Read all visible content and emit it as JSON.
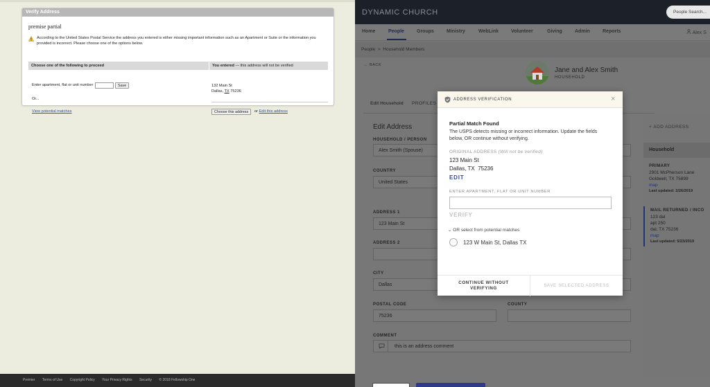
{
  "left": {
    "panel_title": "Verify Address",
    "premise": "premise partial",
    "warning": "According to the United States Postal Service the address you entered is either missing important information such as an Apartment or Suite or the information you provided is incorrect. Please choose one of the options below.",
    "choose_header": "Choose one of the following to proceed",
    "entered_header_bold": "You entered",
    "entered_header_rest": " — this address will not be verified",
    "apt_label": "Enter apartment, flat or unit number",
    "save_label": "Save",
    "or_label": "Or...",
    "view_matches": "View potential matches",
    "entered_line1": "132 Main St",
    "entered_city": "Dallas, ",
    "entered_state": "TX",
    "entered_zip": " 75236",
    "choose_button": "Choose this address",
    "or_small": " or ",
    "edit_link": "Edit this address",
    "footer": [
      "Premier",
      "Terms of Use",
      "Copyright Policy",
      "Your Privacy Rights",
      "Security",
      "© 2018 Fellowship One"
    ]
  },
  "right": {
    "brand": "DYNAMIC CHURCH",
    "search_placeholder": "People Search...",
    "nav": [
      "Home",
      "People",
      "Groups",
      "Ministry",
      "WebLink",
      "Volunteer",
      "Giving",
      "Admin",
      "Reports"
    ],
    "active_nav": "People",
    "user": "Alex S",
    "breadcrumb": [
      "People",
      "Household Members"
    ],
    "back": "BACK",
    "household_name": "Jane and Alex Smith",
    "household_type": "HOUSEHOLD",
    "tabs": [
      "Edit Household",
      "PROFILES"
    ],
    "form": {
      "title": "Edit Address",
      "household_label": "HOUSEHOLD / PERSON",
      "household_value": "Alex Smith (Spouse)",
      "country_label": "COUNTRY",
      "country_value": "United States",
      "address1_label": "ADDRESS 1",
      "address1_value": "123 Main St",
      "address2_label": "ADDRESS 2",
      "address2_value": "",
      "city_label": "CITY",
      "city_value": "Dallas",
      "postal_label": "POSTAL CODE",
      "postal_value": "75236",
      "county_label": "COUNTY",
      "county_value": "",
      "comment_label": "COMMENT",
      "comment_value": "this is an address comment"
    },
    "side": {
      "add_address": "ADD ADDRESS",
      "heading": "Household",
      "primary_label": "PRIMARY",
      "primary_line1": "2901 McPherson Lane",
      "primary_line2": "Goldwell, TX 75899",
      "map": "map",
      "primary_updated": "Last updated: 2/26/2019",
      "returned_label": "MAIL RETURNED / INCO",
      "returned_line1": "123 dal",
      "returned_line2": "apt 250",
      "returned_line3": "dal, TX 75236",
      "returned_updated": "Last updated: 5/23/2019"
    }
  },
  "modal": {
    "title": "ADDRESS VERIFICATION",
    "subtitle": "Partial Match Found",
    "description": "The USPS detects missing or incorrect information. Update the fields below, OR continue without verifying.",
    "orig_label": "ORIGINAL ADDRESS",
    "orig_note": "(Will not be verified)",
    "orig_line1": "123 Main St",
    "orig_line2": "Dallas, TX  75236",
    "edit": "EDIT",
    "apt_label": "ENTER APARTMENT, FLAT OR UNIT NUMBER",
    "verify": "VERIFY",
    "or_select": "OR select from potential matches",
    "match": "123 W Main St, Dallas TX",
    "continue_line1": "CONTINUE WITHOUT",
    "continue_line2": "VERIFYING",
    "save_selected": "SAVE SELECTED ADDRESS"
  },
  "colors": {
    "topbar": "#1c2029",
    "brand_blue": "#2846a8",
    "nav_active": "#1f2a52"
  }
}
